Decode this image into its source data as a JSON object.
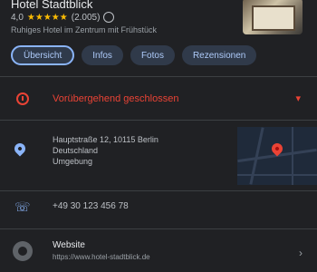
{
  "header": {
    "title": "Hotel Stadtblick",
    "rating": "4,0",
    "stars": "★★★★★",
    "review_count": "(2.005)",
    "subline": "Ruhiges Hotel im Zentrum mit Frühstück"
  },
  "chips": [
    "Übersicht",
    "Infos",
    "Fotos",
    "Rezensionen"
  ],
  "hours": {
    "status_text": "Vorübergehend geschlossen",
    "chevron": "▾"
  },
  "address": {
    "lines": [
      "Hauptstraße 12, 10115 Berlin",
      "Deutschland",
      "Umgebung"
    ]
  },
  "phone": {
    "icon": "☏",
    "number": "+49 30 123 456 78"
  },
  "website": {
    "title": "Website",
    "url": "https://www.hotel-stadtblick.de",
    "chevron": "›"
  },
  "colors": {
    "background": "#202124",
    "accent": "#8ab4f8",
    "closed": "#ea4335",
    "star": "#fbbc04"
  },
  "icons": {
    "hours": "clock-icon",
    "address": "location-pin-icon",
    "phone": "phone-icon",
    "website": "globe-icon"
  }
}
